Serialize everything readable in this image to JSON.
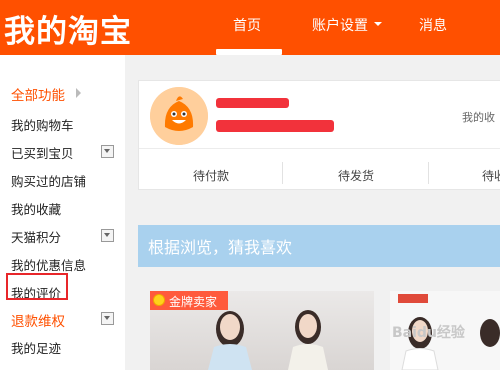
{
  "header": {
    "logo": "我的淘宝",
    "nav": [
      {
        "label": "首页"
      },
      {
        "label": "账户设置"
      },
      {
        "label": "消息"
      }
    ],
    "bg_color": "#ff5000"
  },
  "sidebar": {
    "items": [
      {
        "label": "全部功能"
      },
      {
        "label": "我的购物车"
      },
      {
        "label": "已买到宝贝"
      },
      {
        "label": "购买过的店铺"
      },
      {
        "label": "我的收藏"
      },
      {
        "label": "天猫积分"
      },
      {
        "label": "我的优惠信息"
      },
      {
        "label": "我的评价"
      },
      {
        "label": "退款维权"
      },
      {
        "label": "我的足迹"
      }
    ],
    "accent_color": "#ff5000"
  },
  "profile": {
    "my_collect": "我的收"
  },
  "orders": {
    "tabs": [
      {
        "label": "待付款"
      },
      {
        "label": "待发货"
      },
      {
        "label": "待收"
      }
    ]
  },
  "recommend": {
    "title": "根据浏览，猜我喜欢",
    "badge": "金牌卖家"
  },
  "watermark": "Baidu经验"
}
